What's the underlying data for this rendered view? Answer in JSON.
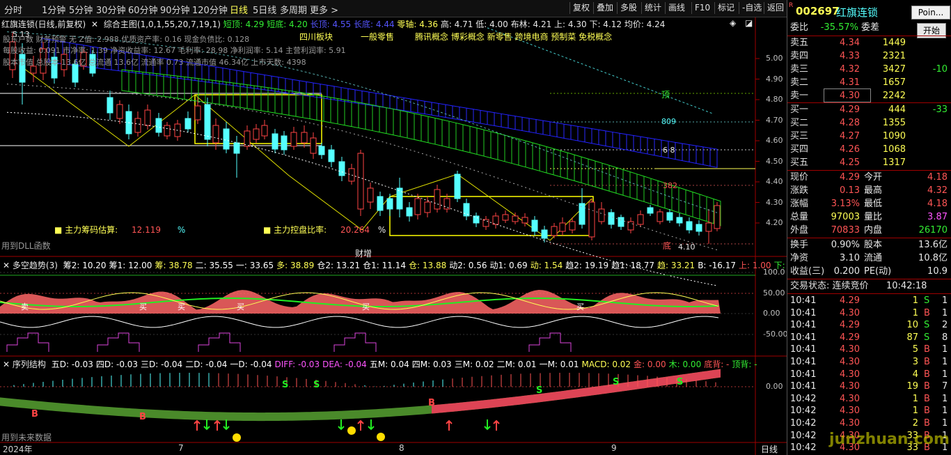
{
  "toolbar": {
    "tabs": [
      "分时",
      "1分钟",
      "5分钟",
      "30分钟",
      "60分钟",
      "90分钟",
      "120分钟",
      "日线",
      "5日线",
      "多周期",
      "更多 >"
    ],
    "active_tab": "日线",
    "right_buttons": [
      "复权",
      "叠加",
      "多股",
      "统计",
      "画线",
      "F10",
      "标记",
      "-自选",
      "返回"
    ]
  },
  "main_chart": {
    "stock_label": "红旗连锁(日线,前复权)",
    "formula_label": "综合主图(1,0,1,55,20,7,19,1)",
    "legend": {
      "short_top": "短顶: 4.29",
      "short_bottom": "短底: 4.20",
      "long_top": "长顶: 4.55",
      "long_bottom": "长底: 4.44",
      "zero_axis": "零轴: 4.36",
      "high": "高: 4.71",
      "low": "低: 4.00",
      "boll": "布林: 4.21",
      "upper": "上: 4.30",
      "lower": "下: 4.12",
      "avg": "均价: 4.24"
    },
    "concepts": [
      "四川板块",
      "一般零售",
      "腾讯概念 博彩概念 新零售 跨境电商 预制菜 免税概念"
    ],
    "price_levels": [
      "5.00",
      "4.90",
      "4.80",
      "4.70",
      "4.60",
      "4.50",
      "4.40",
      "4.30",
      "4.20"
    ],
    "top_price_label": "5.13",
    "info_line1": "股东户数 财务预警 无 Z值: 2.988 优质资产率: 0.16 现金负债比: 0.128",
    "info_line2": "每股收益: 0.091 市净率: 1.39 净资收益率: 12.67 毛利率: 28.98 净利润率: 5.14 主营利润率: 5.91",
    "info_line3": "股本市值 总股本 13.6亿 总流通 13.6亿 流通率 0.73 流通市值 46.34亿 上市天数: 4398",
    "chip_label": "主力筹码估算:",
    "chip_value": "12.119",
    "chip_unit": "%",
    "control_label": "主力控盘比率:",
    "control_value": "20.264",
    "control_unit": "%",
    "dll_label": "用到DLL函数",
    "caizeng": "财增",
    "annot_ding": "顶",
    "annot_809": "809",
    "annot_618": "6 8",
    "annot_382": "382",
    "annot_di": "底",
    "low_mark": "4.10"
  },
  "indicator1": {
    "title": "多空趋势(3)",
    "values": [
      "筹2: 10.20",
      "筹1: 12.00",
      "筹: 38.78",
      "二: 35.55",
      "一: 33.65",
      "多: 38.89",
      "仓2: 13.21",
      "仓1: 11.14",
      "仓: 13.88",
      "动2: 0.56",
      "动1: 0.69",
      "动: 1.54",
      "趋2: 19.19",
      "趋1: 18.77",
      "趋: 33.21",
      "B: -16.17",
      "上: 1.00",
      "下: 0.00"
    ],
    "axis": [
      "100.0",
      "50.00",
      "0.00",
      "-50.00"
    ],
    "marks": [
      "卖",
      "买",
      "买",
      "买",
      "买",
      "买"
    ]
  },
  "indicator2": {
    "title": "序列结构",
    "values": [
      "五D: -0.03",
      "四D: -0.03",
      "三D: -0.04",
      "二D: -0.04",
      "一D: -0.04",
      "DIFF: -0.03",
      "DEA: -0.04",
      "五M: 0.04",
      "四M: 0.03",
      "三M: 0.02",
      "二M: 0.01",
      "一M: 0.01",
      "MACD: 0.02",
      "金: 0.00",
      "木: 0.00",
      "底背: -",
      "顶背: -"
    ],
    "axis": [
      "0.00"
    ],
    "future_label": "用到未来数据",
    "signals": [
      "S",
      "S",
      "S",
      "S",
      "S",
      "B",
      "B",
      "B"
    ]
  },
  "date_axis": {
    "labels": [
      "2024年",
      "7",
      "8",
      "9"
    ],
    "period": "日线"
  },
  "quote": {
    "code": "002697",
    "name": "红旗连锁",
    "r_mark": "R",
    "popup_title": "Poin...",
    "open_btn": "开始",
    "webi_label": "委比",
    "webi_value": "-35.57%",
    "weicha_label": "委差",
    "sells": [
      {
        "label": "卖五",
        "price": "4.34",
        "vol": "1449",
        "chg": ""
      },
      {
        "label": "卖四",
        "price": "4.33",
        "vol": "2321",
        "chg": ""
      },
      {
        "label": "卖三",
        "price": "4.32",
        "vol": "3427",
        "chg": "-10"
      },
      {
        "label": "卖二",
        "price": "4.31",
        "vol": "1657",
        "chg": ""
      },
      {
        "label": "卖一",
        "price": "4.30",
        "vol": "2242",
        "chg": ""
      }
    ],
    "buys": [
      {
        "label": "买一",
        "price": "4.29",
        "vol": "444",
        "chg": "-33"
      },
      {
        "label": "买二",
        "price": "4.28",
        "vol": "1355",
        "chg": ""
      },
      {
        "label": "买三",
        "price": "4.27",
        "vol": "1090",
        "chg": ""
      },
      {
        "label": "买四",
        "price": "4.26",
        "vol": "1068",
        "chg": ""
      },
      {
        "label": "买五",
        "price": "4.25",
        "vol": "1317",
        "chg": ""
      }
    ],
    "stats": [
      {
        "l1": "现价",
        "v1": "4.29",
        "c1": "red",
        "l2": "今开",
        "v2": "4.18",
        "c2": "red"
      },
      {
        "l1": "涨跌",
        "v1": "0.13",
        "c1": "red",
        "l2": "最高",
        "v2": "4.32",
        "c2": "red"
      },
      {
        "l1": "涨幅",
        "v1": "3.13%",
        "c1": "red",
        "l2": "最低",
        "v2": "4.18",
        "c2": "red"
      },
      {
        "l1": "总量",
        "v1": "97003",
        "c1": "yellow",
        "l2": "量比",
        "v2": "3.87",
        "c2": "magenta"
      },
      {
        "l1": "外盘",
        "v1": "70833",
        "c1": "red",
        "l2": "内盘",
        "v2": "26170",
        "c2": "green"
      }
    ],
    "fund": [
      {
        "l1": "换手",
        "v1": "0.90%",
        "l2": "股本",
        "v2": "13.6亿"
      },
      {
        "l1": "净资",
        "v1": "3.10",
        "l2": "流通",
        "v2": "10.8亿"
      },
      {
        "l1": "收益(三)",
        "v1": "0.200",
        "l2": "PE(动)",
        "v2": "10.9"
      }
    ],
    "trade_status_label": "交易状态: 连续竞价",
    "trade_time": "10:42:18",
    "ticks": [
      {
        "t": "10:41",
        "p": "4.29",
        "v": "1",
        "s": "S",
        "n": "1"
      },
      {
        "t": "10:41",
        "p": "4.30",
        "v": "1",
        "s": "B",
        "n": "1"
      },
      {
        "t": "10:41",
        "p": "4.29",
        "v": "10",
        "s": "S",
        "n": "2"
      },
      {
        "t": "10:41",
        "p": "4.29",
        "v": "87",
        "s": "S",
        "n": "8"
      },
      {
        "t": "10:41",
        "p": "4.30",
        "v": "5",
        "s": "B",
        "n": "1"
      },
      {
        "t": "10:41",
        "p": "4.30",
        "v": "3",
        "s": "B",
        "n": "1"
      },
      {
        "t": "10:41",
        "p": "4.30",
        "v": "4",
        "s": "B",
        "n": "1"
      },
      {
        "t": "10:41",
        "p": "4.30",
        "v": "19",
        "s": "B",
        "n": "7"
      },
      {
        "t": "10:42",
        "p": "4.30",
        "v": "1",
        "s": "B",
        "n": "1"
      },
      {
        "t": "10:42",
        "p": "4.30",
        "v": "1",
        "s": "B",
        "n": "1"
      },
      {
        "t": "10:42",
        "p": "4.30",
        "v": "2",
        "s": "B",
        "n": "1"
      },
      {
        "t": "10:42",
        "p": "4.30",
        "v": "33",
        "s": "B",
        "n": "1"
      },
      {
        "t": "10:42",
        "p": "4.30",
        "v": "33",
        "s": "B",
        "n": "1"
      }
    ],
    "watermark": "junzhuan.com"
  },
  "colors": {
    "up": "#ff4444",
    "down": "#55ffff",
    "ma_yellow": "#ffff00",
    "band_blue": "#1a1aff",
    "band_green": "#22cc22"
  }
}
